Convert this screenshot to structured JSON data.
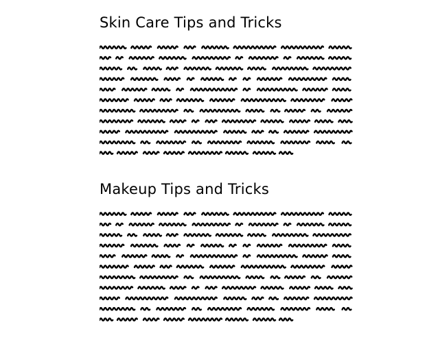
{
  "document": {
    "sections": [
      {
        "title": "Skin Care Tips and Tricks"
      },
      {
        "title": "Makeup Tips and Tricks"
      }
    ],
    "colors": {
      "background": "#ffffff",
      "text": "#000000"
    }
  }
}
